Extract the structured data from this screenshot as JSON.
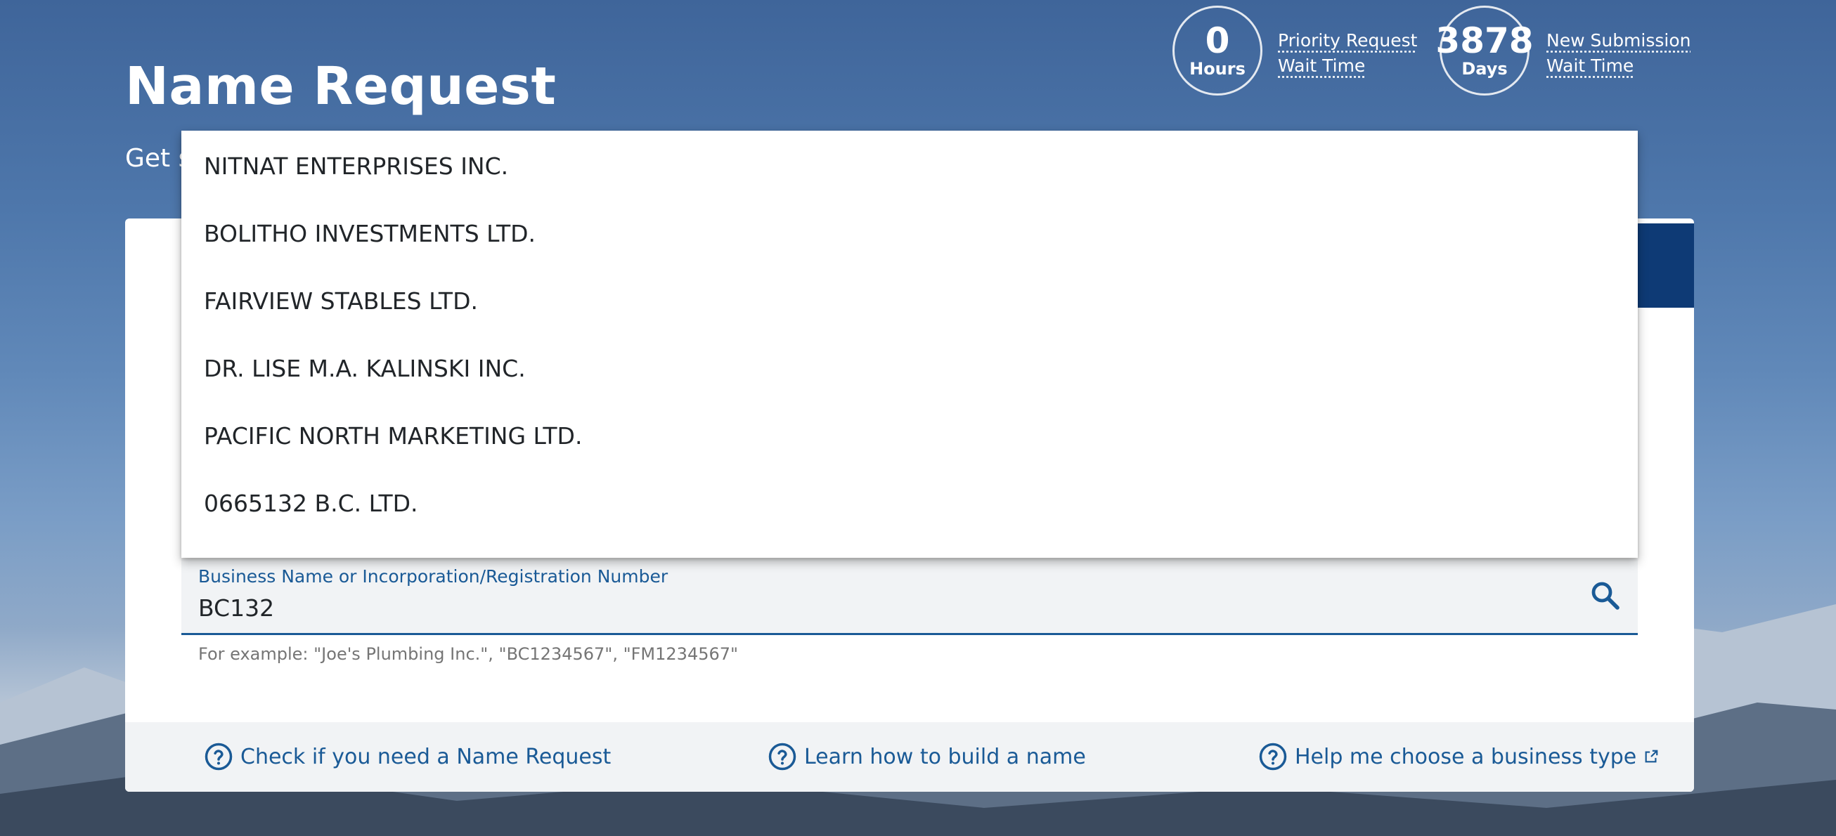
{
  "header": {
    "title": "Name Request",
    "subtitle_visible": "Get s"
  },
  "stats": {
    "priority": {
      "number": "0",
      "unit": "Hours",
      "link_line1": "Priority Request",
      "link_line2": "Wait Time"
    },
    "new": {
      "number": "3878",
      "unit": "Days",
      "link_line1": "New Submission",
      "link_line2": "Wait Time"
    }
  },
  "search": {
    "label": "Business Name or Incorporation/Registration Number",
    "value": "BC132",
    "hint": "For example: \"Joe's Plumbing Inc.\", \"BC1234567\", \"FM1234567\""
  },
  "dropdown": {
    "items": [
      "NITNAT ENTERPRISES INC.",
      "BOLITHO INVESTMENTS LTD.",
      "FAIRVIEW STABLES LTD.",
      "DR. LISE M.A. KALINSKI INC.",
      "PACIFIC NORTH MARKETING LTD.",
      "0665132 B.C. LTD."
    ]
  },
  "footer": {
    "links": [
      {
        "label": "Check if you need a Name Request",
        "icon": "help-circle-icon"
      },
      {
        "label": "Learn how to build a name",
        "icon": "help-circle-icon"
      },
      {
        "label": "Help me choose a business type",
        "icon": "help-circle-icon",
        "trailing_icon": "external-link-icon"
      }
    ]
  },
  "colors": {
    "primary_blue": "#1a5a96",
    "dark_navy": "#0e3a75",
    "footer_bg": "#f1f3f5"
  }
}
